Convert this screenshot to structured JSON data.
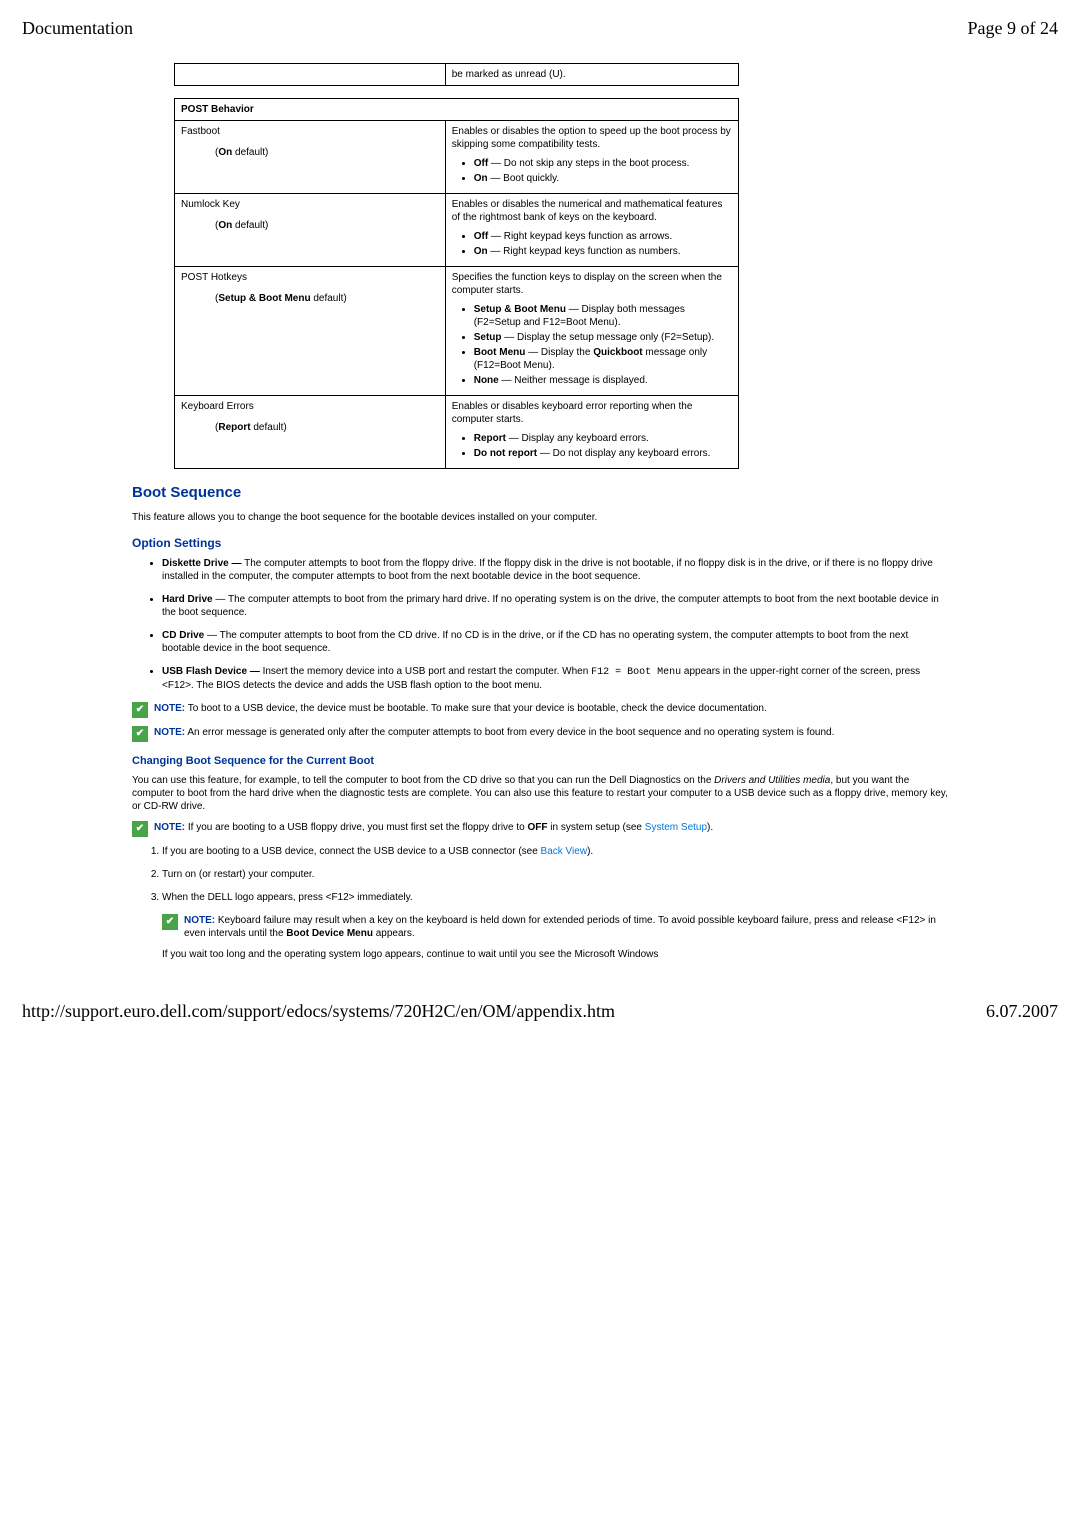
{
  "header": {
    "title": "Documentation",
    "page": "Page 9 of 24"
  },
  "tableTop": {
    "row": {
      "cell2": "be marked as unread (U)."
    }
  },
  "tableMain": {
    "header": "POST Behavior",
    "rows": [
      {
        "leftTitle": "Fastboot",
        "leftSub": "(On default)",
        "right": "Enables or disables the option to speed up the boot process by skipping some compatibility tests.",
        "bullets": [
          {
            "label": "Off",
            "text": "— Do not skip any steps in the boot process."
          },
          {
            "label": "On",
            "text": "— Boot quickly."
          }
        ]
      },
      {
        "leftTitle": "Numlock Key",
        "leftSub": "(On default)",
        "right": "Enables or disables the numerical and mathematical features of the rightmost bank of keys on the keyboard.",
        "bullets": [
          {
            "label": "Off",
            "text": "— Right keypad keys function as arrows."
          },
          {
            "label": "On",
            "text": "— Right keypad keys function as numbers."
          }
        ]
      },
      {
        "leftTitle": "POST Hotkeys",
        "leftSub": "(Setup & Boot Menu default)",
        "right": "Specifies the function keys to display on the screen when the computer starts.",
        "bullets": [
          {
            "label": "Setup & Boot Menu",
            "text": "— Display both messages (F2=Setup and F12=Boot Menu)."
          },
          {
            "label": "Setup",
            "text": "— Display the setup message only (F2=Setup)."
          },
          {
            "label": "Boot Menu",
            "text": "— Display the Quickboot message only (F12=Boot Menu).",
            "extraBold": "Quickboot"
          },
          {
            "label": "None",
            "text": "— Neither message is displayed."
          }
        ]
      },
      {
        "leftTitle": "Keyboard Errors",
        "leftSub": "(Report default)",
        "right": "Enables or disables keyboard error reporting when the computer starts.",
        "bullets": [
          {
            "label": "Report",
            "text": "— Display any keyboard errors."
          },
          {
            "label": "Do not report",
            "text": "— Do not display any keyboard errors."
          }
        ]
      }
    ]
  },
  "bootSeq": {
    "title": "Boot Sequence",
    "intro": "This feature allows you to change the boot sequence for the bootable devices installed on your computer.",
    "optionTitle": "Option Settings",
    "options": [
      {
        "label": "Diskette Drive —",
        "text": "The computer attempts to boot from the floppy drive. If the floppy disk in the drive is not bootable, if no floppy disk is in the drive, or if there is no floppy drive installed in the computer, the computer attempts to boot from the next bootable device in the boot sequence."
      },
      {
        "label": "Hard Drive",
        "text": "— The computer attempts to boot from the primary hard drive. If no operating system is on the drive, the computer attempts to boot from the next bootable device in the boot sequence."
      },
      {
        "label": "CD Drive",
        "text": "— The computer attempts to boot from the CD drive. If no CD is in the drive, or if the CD has no operating system, the computer attempts to boot from the next bootable device in the boot sequence."
      },
      {
        "label": "USB Flash Device —",
        "text1": "Insert the memory device into a USB port and restart the computer. When ",
        "code1": "F12 = Boot Menu",
        "text2": " appears in the upper-right corner of the screen, press <F12>. The BIOS detects the device and adds the USB flash option to the boot menu."
      }
    ],
    "notes": [
      {
        "label": "NOTE:",
        "text": "To boot to a USB device, the device must be bootable. To make sure that your device is bootable, check the device documentation."
      },
      {
        "label": "NOTE:",
        "text": "An error message is generated only after the computer attempts to boot from every device in the boot sequence and no operating system is found."
      }
    ]
  },
  "changeBoot": {
    "title": "Changing Boot Sequence for the Current Boot",
    "para1a": "You can use this feature, for example, to tell the computer to boot from the CD drive so that you can run the Dell Diagnostics on the ",
    "para1i": "Drivers and Utilities media",
    "para1b": ", but you want the computer to boot from the hard drive when the diagnostic tests are complete. You can also use this feature to restart your computer to a USB device such as a floppy drive, memory key, or CD-RW drive.",
    "note1": {
      "label": "NOTE:",
      "text1": "If you are booting to a USB floppy drive, you must first set the floppy drive to ",
      "bold": "OFF",
      "text2": " in system setup (see ",
      "link": "System Setup",
      "text3": ")."
    },
    "steps": [
      {
        "text1": "If you are booting to a USB device, connect the USB device to a USB connector (see ",
        "link": "Back View",
        "text2": ")."
      },
      {
        "text": "Turn on (or restart) your computer."
      },
      {
        "text": "When the DELL logo appears, press <F12> immediately."
      }
    ],
    "nestedNote": {
      "label": "NOTE:",
      "text1": "Keyboard failure may result when a key on the keyboard is held down for extended periods of time. To avoid possible keyboard failure, press and release <F12> in even intervals until the ",
      "bold": "Boot Device Menu",
      "text2": " appears."
    },
    "trailing": "If you wait too long and the operating system logo appears, continue to wait until you see the Microsoft Windows"
  },
  "footer": {
    "url": "http://support.euro.dell.com/support/edocs/systems/720H2C/en/OM/appendix.htm",
    "date": "6.07.2007"
  }
}
